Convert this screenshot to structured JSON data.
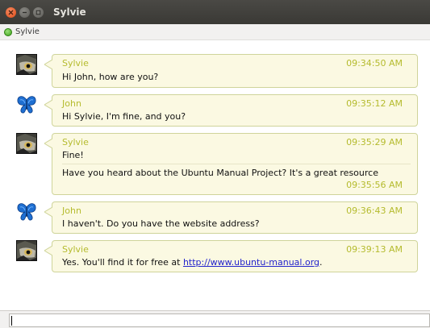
{
  "window": {
    "title": "Sylvie"
  },
  "status": {
    "contact_name": "Sylvie",
    "presence_color": "#3ea31a"
  },
  "colors": {
    "bubble_bg": "#fbf9e2",
    "bubble_border": "#cfd49a",
    "sender_color": "#b5bb2e",
    "link_color": "#2222cc"
  },
  "messages": [
    {
      "sender": "Sylvie",
      "avatar": "owl-icon",
      "lines": [
        {
          "text": "Hi John, how are you?",
          "time": "09:34:50 AM"
        }
      ]
    },
    {
      "sender": "John",
      "avatar": "butterfly-icon",
      "lines": [
        {
          "text": "Hi Sylvie, I'm fine, and you?",
          "time": "09:35:12 AM"
        }
      ]
    },
    {
      "sender": "Sylvie",
      "avatar": "owl-icon",
      "lines": [
        {
          "text": "Fine!",
          "time": "09:35:29 AM"
        },
        {
          "text": "Have you heard about the Ubuntu Manual Project? It's a great resource",
          "time": "09:35:56 AM"
        }
      ]
    },
    {
      "sender": "John",
      "avatar": "butterfly-icon",
      "lines": [
        {
          "text": "I haven't. Do you have the website address?",
          "time": "09:36:43 AM"
        }
      ]
    },
    {
      "sender": "Sylvie",
      "avatar": "owl-icon",
      "lines": [
        {
          "text_prefix": "Yes. You'll find it for free at ",
          "link": "http://www.ubuntu-manual.org",
          "text_suffix": ".",
          "time": "09:39:13 AM"
        }
      ]
    }
  ],
  "input": {
    "value": ""
  }
}
